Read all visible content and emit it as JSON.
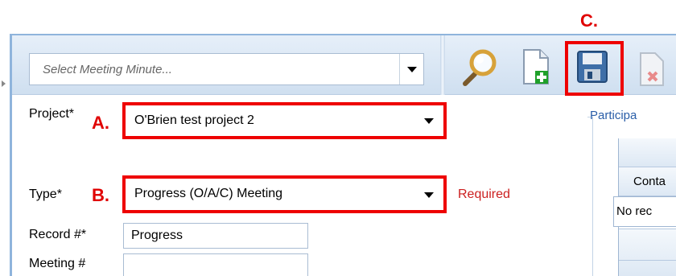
{
  "annotations": {
    "a": "A.",
    "b": "B.",
    "c": "C."
  },
  "toolbar": {
    "meeting_select_placeholder": "Select Meeting Minute...",
    "buttons": [
      {
        "name": "search",
        "icon": "magnifier-icon"
      },
      {
        "name": "new",
        "icon": "new-document-icon"
      },
      {
        "name": "save",
        "icon": "floppy-disk-icon"
      },
      {
        "name": "delete",
        "icon": "delete-document-icon"
      }
    ]
  },
  "form": {
    "project_label": "Project*",
    "project_value": "O'Brien test project 2",
    "type_label": "Type*",
    "type_value": "Progress (O/A/C) Meeting",
    "required_text": "Required",
    "record_label": "Record #*",
    "record_value": "Progress",
    "meeting_label": "Meeting #",
    "meeting_value": ""
  },
  "participants": {
    "legend": "Participa",
    "column_header": "Conta",
    "empty_text": "No rec"
  },
  "colors": {
    "annotation_red": "#ee0000",
    "required_red": "#cc1f1f",
    "legend_blue": "#2a5ea8",
    "toolbar_bg": "#dbe7f4"
  }
}
